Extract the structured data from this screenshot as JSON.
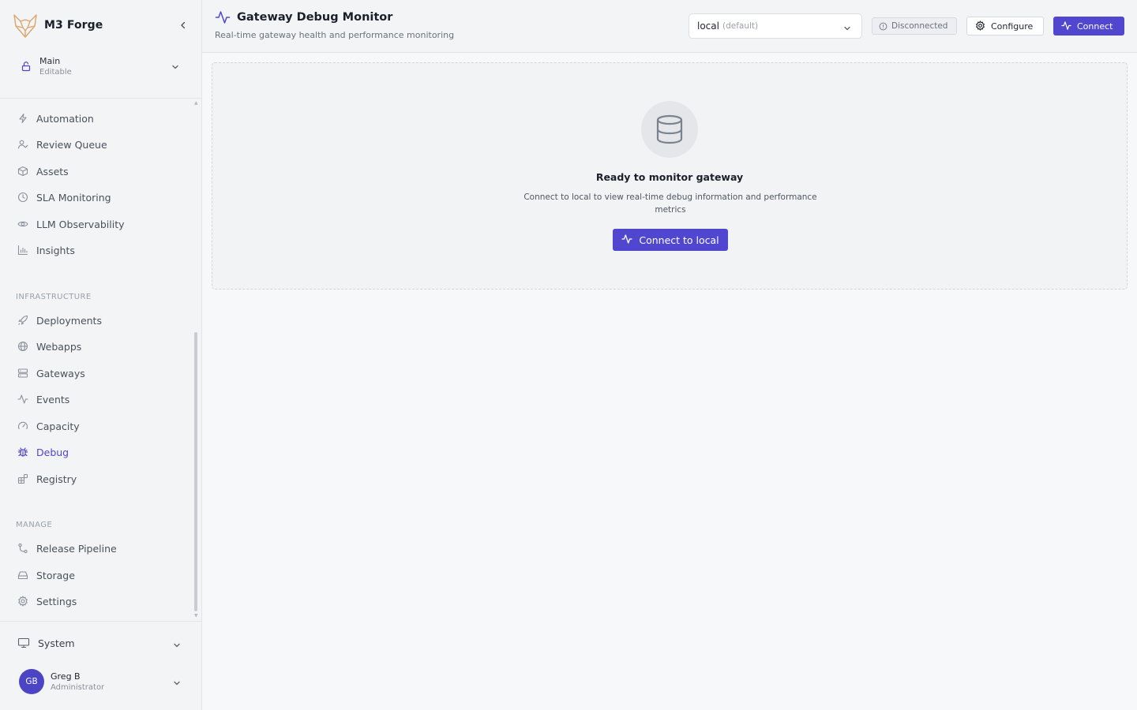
{
  "sidebar": {
    "brand_name": "M3 Forge",
    "workspace": {
      "name": "Main",
      "mode": "Editable"
    },
    "items": [
      {
        "label": "Automation",
        "icon": "zap-icon"
      },
      {
        "label": "Review Queue",
        "icon": "user-check-icon"
      },
      {
        "label": "Assets",
        "icon": "box-icon"
      },
      {
        "label": "SLA Monitoring",
        "icon": "clock-icon"
      },
      {
        "label": "LLM Observability",
        "icon": "eye-icon"
      },
      {
        "label": "Insights",
        "icon": "bar-chart-icon"
      }
    ],
    "infrastructure": {
      "label": "INFRASTRUCTURE",
      "items": [
        {
          "label": "Deployments",
          "icon": "rocket-icon"
        },
        {
          "label": "Webapps",
          "icon": "globe-icon"
        },
        {
          "label": "Gateways",
          "icon": "server-icon"
        },
        {
          "label": "Events",
          "icon": "activity-icon"
        },
        {
          "label": "Capacity",
          "icon": "gauge-icon"
        },
        {
          "label": "Debug",
          "icon": "bug-icon",
          "active": true
        },
        {
          "label": "Registry",
          "icon": "blocks-icon"
        }
      ]
    },
    "manage": {
      "label": "MANAGE",
      "items": [
        {
          "label": "Release Pipeline",
          "icon": "git-branch-icon"
        },
        {
          "label": "Storage",
          "icon": "hard-drive-icon"
        },
        {
          "label": "Settings",
          "icon": "gear-icon"
        }
      ]
    },
    "system": {
      "label": "System",
      "icon": "monitor-icon"
    },
    "user": {
      "initials": "GB",
      "name": "Greg B",
      "role": "Administrator"
    }
  },
  "header": {
    "title": "Gateway Debug Monitor",
    "subtitle": "Real-time gateway health and performance monitoring",
    "environment": {
      "value": "local",
      "default_tag": "(default)"
    },
    "status": "Disconnected",
    "configure_label": "Configure",
    "connect_label": "Connect"
  },
  "empty_state": {
    "title": "Ready to monitor gateway",
    "description": "Connect to local to view real-time debug information and performance metrics",
    "button_label": "Connect to local"
  },
  "colors": {
    "accent": "#5046d0",
    "active_nav": "#4f46c8",
    "sidebar_bg": "#f3f4f6",
    "page_bg": "#f7f8fa"
  }
}
